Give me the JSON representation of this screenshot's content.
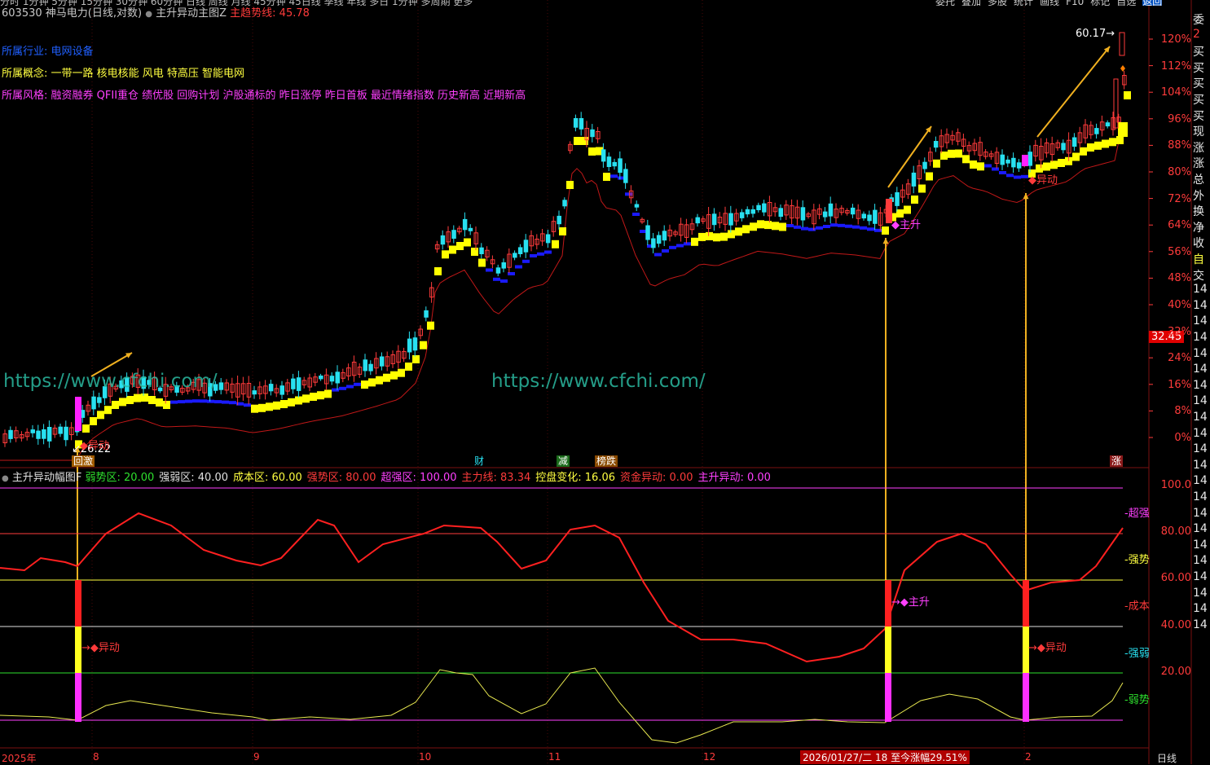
{
  "colors": {
    "up": "#ff3b3b",
    "down": "#28e0f0",
    "main_rise": "#ffff00",
    "adjust": "#1a1aff",
    "ma": "#c01818",
    "power": "#ff2020",
    "wave": "#e8e850"
  },
  "topbar": {
    "menu_text": "分时  1分钟  5分钟  15分钟  30分钟  60分钟  日线  周线  月线  45分钟  45日线  季线  年线  多日  1分钟  多周期  更多",
    "right_buttons": [
      "委托",
      "叠加",
      "多股",
      "统计",
      "画线",
      "F10",
      "标记",
      "自选",
      "返回"
    ]
  },
  "header": {
    "code": "603530",
    "name": "神马电力",
    "mode": "(日线,对数)",
    "indicator": "主升异动主图Z",
    "trend_label": "主趋势线:",
    "trend_value": "45.78"
  },
  "info": {
    "industry_label": "所属行业:",
    "industry": "电网设备",
    "concept_label": "所属概念:",
    "concept": "一带一路 核电核能 风电 特高压 智能电网",
    "style_label": "所属风格:",
    "style": "融资融券 QFII重仓 绩优股 回购计划 沪股通标的 昨日涨停 昨日首板 最近情绪指数 历史新高 近期新高"
  },
  "watermark": "https://www.cfchi.com/",
  "price_markers": {
    "low": "26.22",
    "high": "60.17",
    "last": "32.45"
  },
  "main_labels": {
    "yidong": "异动",
    "zhusheng": "主升"
  },
  "events": [
    {
      "label": "回激"
    },
    {
      "label": "财"
    },
    {
      "label": "减"
    },
    {
      "label": "榜跌"
    },
    {
      "label": "涨"
    }
  ],
  "y_axis_main": [
    "120%",
    "112%",
    "104%",
    "96%",
    "88%",
    "80%",
    "72%",
    "64%",
    "56%",
    "48%",
    "40%",
    "32%",
    "24%",
    "16%",
    "8%",
    "0%"
  ],
  "lower_header": {
    "name": "主升异动幅图F",
    "items": [
      {
        "label": "弱势区:",
        "value": "20.00",
        "color": "#2ee02e"
      },
      {
        "label": "强弱区:",
        "value": "40.00",
        "color": "#e0e0e0"
      },
      {
        "label": "成本区:",
        "value": "60.00",
        "color": "#ffff40"
      },
      {
        "label": "强势区:",
        "value": "80.00",
        "color": "#ff3b3b"
      },
      {
        "label": "超强区:",
        "value": "100.00",
        "color": "#ff40ff"
      },
      {
        "label": "主力线:",
        "value": "83.34",
        "color": "#ff3b3b"
      },
      {
        "label": "控盘变化:",
        "value": "16.06",
        "color": "#ffff40"
      },
      {
        "label": "资金异动:",
        "value": "0.00",
        "color": "#ff3b3b"
      },
      {
        "label": "主升异动:",
        "value": "0.00",
        "color": "#ff40ff"
      }
    ]
  },
  "lower_zones": [
    {
      "label": "超强",
      "color": "#ff40ff"
    },
    {
      "label": "强势",
      "color": "#ffff40"
    },
    {
      "label": "成本",
      "color": "#ff3b3b"
    },
    {
      "label": "强弱",
      "color": "#28e0f0"
    },
    {
      "label": "弱势",
      "color": "#2ee02e"
    }
  ],
  "y_axis_lower": [
    "100.0",
    "80.00",
    "60.00",
    "40.00",
    "20.00"
  ],
  "x_axis": {
    "labels": [
      "2025年",
      "8",
      "9",
      "10",
      "11",
      "12",
      "2"
    ],
    "cursor": "2026/01/27/二 18 至今涨幅29.51%",
    "period": "日线"
  },
  "right_panel": {
    "items": [
      "委",
      "2",
      "买",
      "买",
      "买",
      "买",
      "买",
      "现",
      "涨",
      "涨",
      "总",
      "外",
      "换",
      "净",
      "收",
      "自",
      "交",
      "14",
      "14",
      "14",
      "14",
      "14",
      "14",
      "14",
      "14",
      "14",
      "14",
      "14",
      "14",
      "14",
      "14",
      "14",
      "14",
      "14",
      "14",
      "14",
      "14",
      "14",
      "14"
    ]
  },
  "chart_data": [
    {
      "type": "candlestick",
      "title": "603530 神马电力 (日线,对数)",
      "y_axis": {
        "scale": "log-percent",
        "range_pct": [
          -4,
          128
        ],
        "ticks": [
          "0%",
          "8%",
          "16%",
          "24%",
          "32%",
          "40%",
          "48%",
          "56%",
          "64%",
          "72%",
          "80%",
          "88%",
          "96%",
          "104%",
          "112%",
          "120%"
        ]
      },
      "x_axis": {
        "range": [
          "2025-07",
          "2026-02"
        ],
        "ticks": [
          "8",
          "9",
          "10",
          "11",
          "12",
          "2"
        ]
      },
      "series_note": "daily candles; lowest marked 26.22, highest marked 60.17, last 32.45 shown on axis",
      "trend_line": {
        "name": "主趋势线",
        "last": 45.78
      }
    },
    {
      "type": "line",
      "title": "主升异动幅图F",
      "y_axis": {
        "range": [
          0,
          100
        ],
        "ticks": [
          20,
          40,
          60,
          80,
          100
        ]
      },
      "levels": [
        {
          "name": "弱势区",
          "value": 20
        },
        {
          "name": "强弱区",
          "value": 40
        },
        {
          "name": "成本区",
          "value": 60
        },
        {
          "name": "强势区",
          "value": 80
        },
        {
          "name": "超强区",
          "value": 100
        }
      ],
      "series": [
        {
          "name": "主力线",
          "last": 83.34
        },
        {
          "name": "控盘变化",
          "last": 16.06
        }
      ],
      "signals": [
        {
          "name": "资金异动",
          "last": 0.0
        },
        {
          "name": "主升异动",
          "last": 0.0
        }
      ]
    }
  ]
}
